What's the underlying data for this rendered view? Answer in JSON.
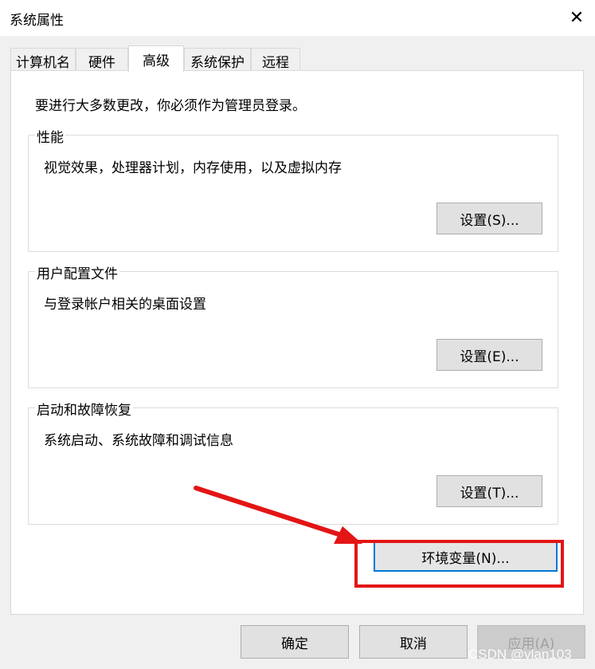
{
  "window": {
    "title": "系统属性",
    "close_symbol": "✕"
  },
  "tabs": [
    {
      "label": "计算机名",
      "active": false
    },
    {
      "label": "硬件",
      "active": false
    },
    {
      "label": "高级",
      "active": true
    },
    {
      "label": "系统保护",
      "active": false
    },
    {
      "label": "远程",
      "active": false
    }
  ],
  "notice": "要进行大多数更改，你必须作为管理员登录。",
  "groups": {
    "performance": {
      "title": "性能",
      "description": "视觉效果，处理器计划，内存使用，以及虚拟内存",
      "button": "设置(S)..."
    },
    "user_profiles": {
      "title": "用户配置文件",
      "description": "与登录帐户相关的桌面设置",
      "button": "设置(E)..."
    },
    "startup_recovery": {
      "title": "启动和故障恢复",
      "description": "系统启动、系统故障和调试信息",
      "button": "设置(T)..."
    }
  },
  "env_button": "环境变量(N)...",
  "footer": {
    "ok": "确定",
    "cancel": "取消",
    "apply": "应用(A)"
  },
  "annotation": {
    "color": "#e31515"
  },
  "watermark": "CSDN @vlan103"
}
